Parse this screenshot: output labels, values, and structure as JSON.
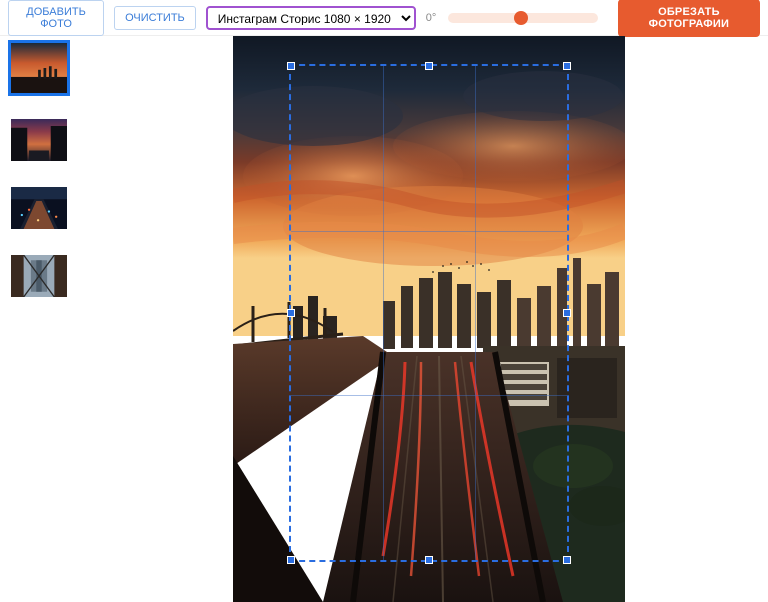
{
  "toolbar": {
    "add_photo": "ДОБАВИТЬ ФОТО",
    "clear": "ОЧИСТИТЬ",
    "preset_selected": "Инстаграм Сторис 1080 × 1920",
    "rotation_label": "0°",
    "crop_button": "ОБРЕЗАТЬ ФОТОГРАФИИ"
  },
  "thumbnails": [
    {
      "name": "city-sunset-skyline",
      "selected": true
    },
    {
      "name": "city-street-dusk",
      "selected": false
    },
    {
      "name": "night-traffic-aerial",
      "selected": false
    },
    {
      "name": "bridge-view",
      "selected": false
    }
  ]
}
